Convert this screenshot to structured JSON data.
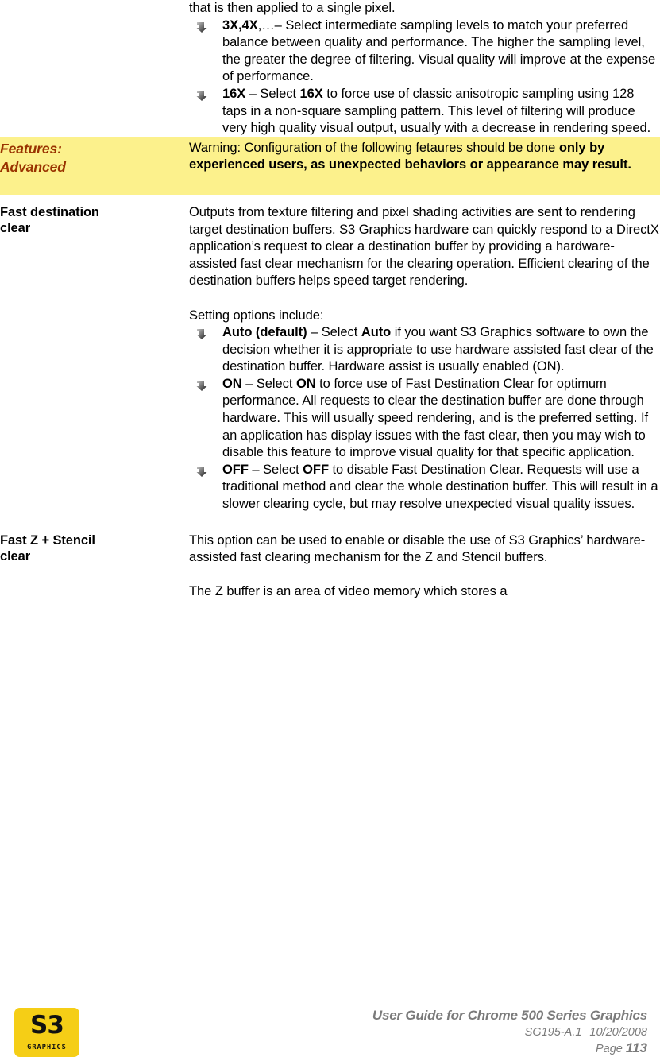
{
  "document": {
    "section_rows": [
      {
        "label": "",
        "continued_text": "that is then applied to a single pixel.",
        "bullets": [
          {
            "lead": "3X,4X",
            "lead_tail": ",…– Select intermediate sampling levels to match your preferred balance between quality and performance. The higher the sampling level, the greater the degree of filtering. Visual quality will improve at the expense of performance."
          },
          {
            "lead": "16X",
            "mid_1": " – Select ",
            "emph": "16X",
            "mid_2": " to force use of classic anisotropic sampling using 128 taps in a non-square sampling pattern. This level of filtering will produce very high quality visual output, usually with a decrease in rendering speed."
          }
        ]
      }
    ],
    "warning_row": {
      "label_line1": "Features:",
      "label_line2": "Advanced",
      "text_normal": "Warning: Configuration of the following fetaures should be done ",
      "text_bold": "only by experienced users, as unexpected behaviors or appearance may result.",
      "background_color": "#fcf18c",
      "label_color": "#993300"
    },
    "fast_destination_clear": {
      "label_line1": "Fast destination",
      "label_line2": "clear",
      "paragraph_1": "Outputs from texture filtering and pixel shading activities are sent to rendering target destination buffers. S3 Graphics hardware can quickly respond to a DirectX application’s request to clear a destination buffer by providing a hardware-assisted fast clear mechanism for the clearing operation. Efficient clearing of the destination buffers helps speed target rendering.",
      "paragraph_2": "Setting options include:",
      "options": [
        {
          "lead": "Auto (default)",
          "mid_1": " – Select ",
          "emph": "Auto",
          "mid_2": " if you want S3 Graphics software to own the decision whether it is appropriate to use hardware assisted fast clear of the destination buffer. Hardware assist is usually enabled (ON)."
        },
        {
          "lead": "ON",
          "mid_1": " – Select ",
          "emph": "ON",
          "mid_2": " to force use of Fast Destination Clear for optimum performance. All requests to clear the destination buffer are done through hardware. This will usually speed rendering, and is the preferred setting. If an application has display issues with the fast clear, then you may wish to disable this feature to improve visual quality for that specific application."
        },
        {
          "lead": "OFF",
          "mid_1": " – Select ",
          "emph": "OFF",
          "mid_2": " to disable Fast Destination Clear. Requests will use a traditional method and clear the whole destination buffer. This will result in a slower clearing cycle, but may resolve unexpected visual quality issues."
        }
      ]
    },
    "fast_z_stencil_clear": {
      "label_line1": "Fast Z + Stencil",
      "label_line2": "clear",
      "paragraph_1": "This option can be used to enable or disable the use of S3 Graphics’ hardware-assisted fast clearing mechanism for the Z and Stencil buffers.",
      "paragraph_2": "The Z buffer is an area of video memory which stores a"
    }
  },
  "footer": {
    "logo": {
      "wordmark": "S3",
      "subtext": "GRAPHICS",
      "background_color": "#f5ce16"
    },
    "title": "User Guide for Chrome 500 Series Graphics",
    "revision": "SG195-A.1",
    "date": "10/20/2008",
    "page_label": "Page",
    "page_number": "113",
    "text_color": "#7b7b7b"
  }
}
